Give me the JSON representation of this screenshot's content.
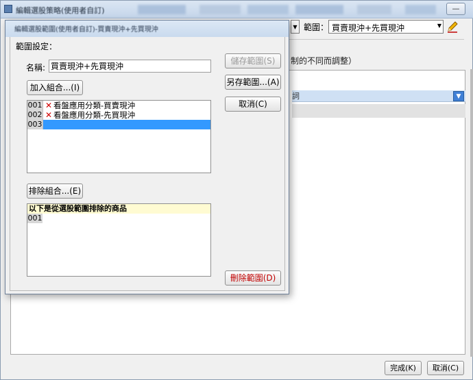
{
  "background": {
    "window_title": "編輯選股策略(使用者自訂)",
    "window_buttons": [
      "—"
    ],
    "range_label": "範圍：",
    "range_value": "買賣現沖+先買現沖",
    "note_text": "制的不同而調整）",
    "grid_header_text": "詞",
    "done_button": "完成(K)",
    "cancel_button": "取消(C)"
  },
  "dialog": {
    "title": "編輯選股範圍(使用者自訂)-買賣現沖+先買現沖",
    "section_label": "範圍設定：",
    "name_label": "名稱:",
    "name_value": "買賣現沖+先買現沖",
    "add_combo_label": "加入組合...(I)",
    "exclude_combo_label": "排除組合...(E)",
    "combos": [
      {
        "num": "001",
        "text": "看盤應用分類-買賣現沖",
        "icon": "x-icon"
      },
      {
        "num": "002",
        "text": "看盤應用分類-先買現沖",
        "icon": "x-icon"
      },
      {
        "num": "003",
        "text": "",
        "icon": ""
      }
    ],
    "exclude_header": "以下是從選股範圍排除的商品",
    "exclude_rows": [
      {
        "num": "001"
      }
    ],
    "save_range_label": "儲存範圍(S)",
    "save_as_label": "另存範圍...(A)",
    "cancel_label": "取消(C)",
    "delete_range_label": "刪除範圍(D)"
  },
  "colors": {
    "selection": "#3399ff",
    "delete_text": "#c00000",
    "exclude_header_bg": "#fffbd2",
    "x_icon": "#d10000"
  }
}
